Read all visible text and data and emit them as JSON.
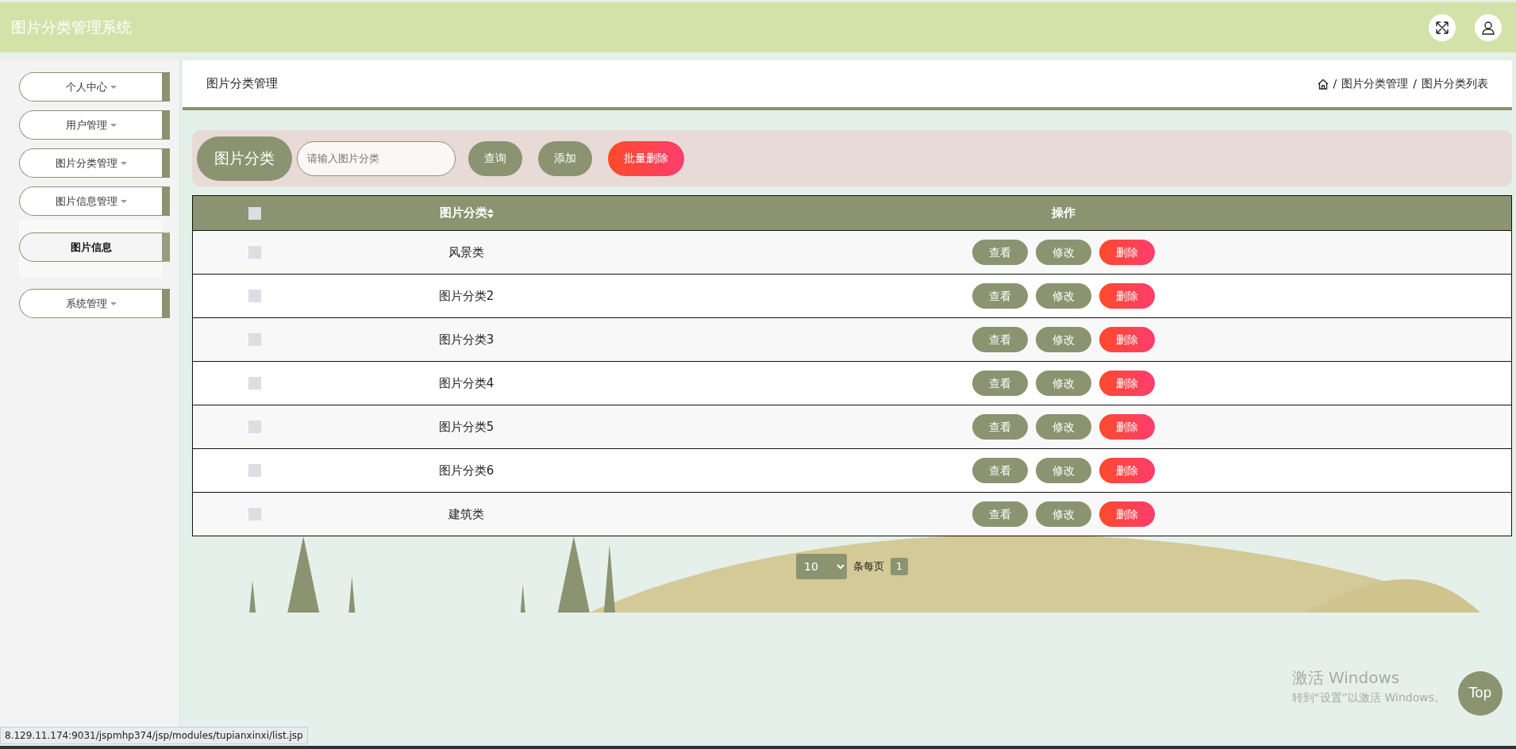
{
  "header": {
    "title": "图片分类管理系统"
  },
  "sidebar": {
    "items": [
      {
        "label": "个人中心"
      },
      {
        "label": "用户管理"
      },
      {
        "label": "图片分类管理"
      },
      {
        "label": "图片信息管理",
        "children": [
          {
            "label": "图片信息"
          }
        ]
      },
      {
        "label": "系统管理"
      }
    ]
  },
  "page": {
    "title": "图片分类管理",
    "breadcrumb": [
      {
        "separator": "/",
        "label": "图片分类管理"
      },
      {
        "separator": "/",
        "label": "图片分类列表"
      }
    ]
  },
  "search": {
    "label": "图片分类",
    "placeholder": "请输入图片分类",
    "buttons": [
      {
        "label": "查询",
        "kind": "normal"
      },
      {
        "label": "添加",
        "kind": "normal"
      },
      {
        "label": "批量删除",
        "kind": "danger"
      }
    ]
  },
  "table": {
    "select_all_checked": false,
    "columns": [
      "图片分类",
      "操作"
    ],
    "rows": [
      {
        "name": "风景类",
        "checked": false,
        "actions": [
          {
            "label": "查看",
            "kind": "normal"
          },
          {
            "label": "修改",
            "kind": "normal"
          },
          {
            "label": "删除",
            "kind": "danger"
          }
        ]
      },
      {
        "name": "图片分类2",
        "checked": false,
        "actions": [
          {
            "label": "查看",
            "kind": "normal"
          },
          {
            "label": "修改",
            "kind": "normal"
          },
          {
            "label": "删除",
            "kind": "danger"
          }
        ]
      },
      {
        "name": "图片分类3",
        "checked": false,
        "actions": [
          {
            "label": "查看",
            "kind": "normal"
          },
          {
            "label": "修改",
            "kind": "normal"
          },
          {
            "label": "删除",
            "kind": "danger"
          }
        ]
      },
      {
        "name": "图片分类4",
        "checked": false,
        "actions": [
          {
            "label": "查看",
            "kind": "normal"
          },
          {
            "label": "修改",
            "kind": "normal"
          },
          {
            "label": "删除",
            "kind": "danger"
          }
        ]
      },
      {
        "name": "图片分类5",
        "checked": false,
        "actions": [
          {
            "label": "查看",
            "kind": "normal"
          },
          {
            "label": "修改",
            "kind": "normal"
          },
          {
            "label": "删除",
            "kind": "danger"
          }
        ]
      },
      {
        "name": "图片分类6",
        "checked": false,
        "actions": [
          {
            "label": "查看",
            "kind": "normal"
          },
          {
            "label": "修改",
            "kind": "normal"
          },
          {
            "label": "删除",
            "kind": "danger"
          }
        ]
      },
      {
        "name": "建筑类",
        "checked": false,
        "actions": [
          {
            "label": "查看",
            "kind": "normal"
          },
          {
            "label": "修改",
            "kind": "normal"
          },
          {
            "label": "删除",
            "kind": "danger"
          }
        ]
      }
    ]
  },
  "pagination": {
    "page_size": "10",
    "label": "条每页",
    "pages": [
      {
        "label": "1",
        "selected": true
      }
    ]
  },
  "top_button": "Top",
  "os_notice": {
    "title": "激活 Windows",
    "text": "转到“设置”以激活 Windows。"
  },
  "status_url": "8.129.11.174:9031/jspmhp374/jsp/modules/tupianxinxi/list.jsp"
}
